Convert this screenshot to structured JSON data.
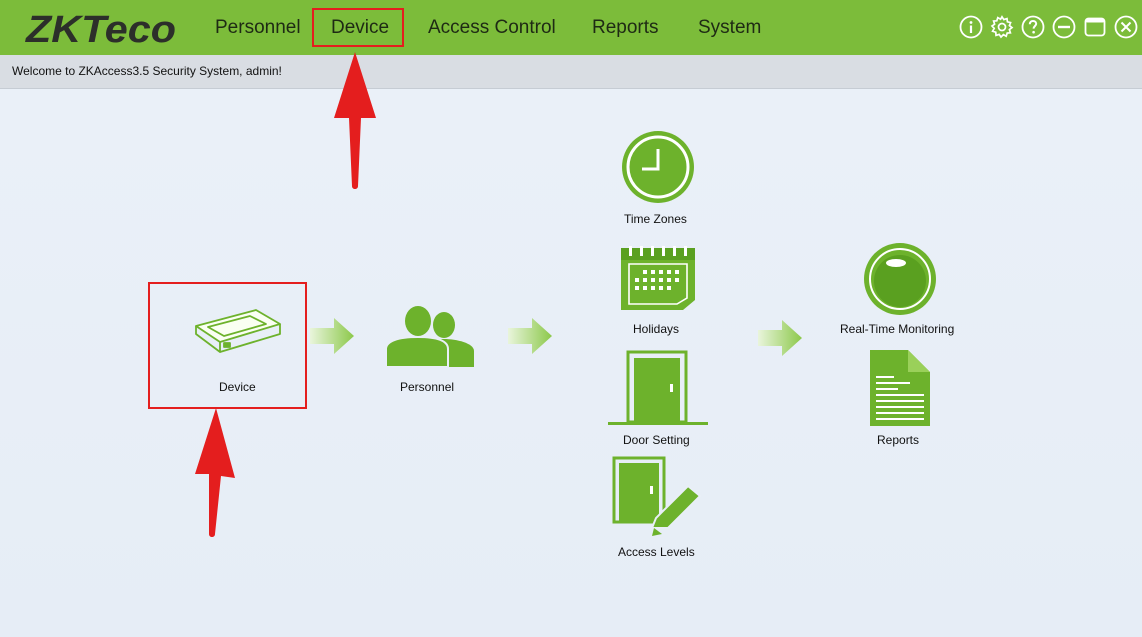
{
  "app": {
    "logo_text": "ZKTeco",
    "menu": [
      {
        "label": "Personnel"
      },
      {
        "label": "Device"
      },
      {
        "label": "Access Control"
      },
      {
        "label": "Reports"
      },
      {
        "label": "System"
      }
    ],
    "window_controls": [
      "info-icon",
      "gear-icon",
      "help-icon",
      "minimize-icon",
      "maximize-icon",
      "close-icon"
    ]
  },
  "welcome": "Welcome to ZKAccess3.5 Security System, admin!",
  "modules": {
    "device": "Device",
    "personnel": "Personnel",
    "time_zones": "Time Zones",
    "holidays": "Holidays",
    "door_setting": "Door Setting",
    "access_levels": "Access Levels",
    "real_time_monitoring": "Real-Time Monitoring",
    "reports": "Reports"
  },
  "colors": {
    "brand_green": "#7cbc3a",
    "icon_green": "#6db22c",
    "annotation_red": "#e41e1e"
  }
}
